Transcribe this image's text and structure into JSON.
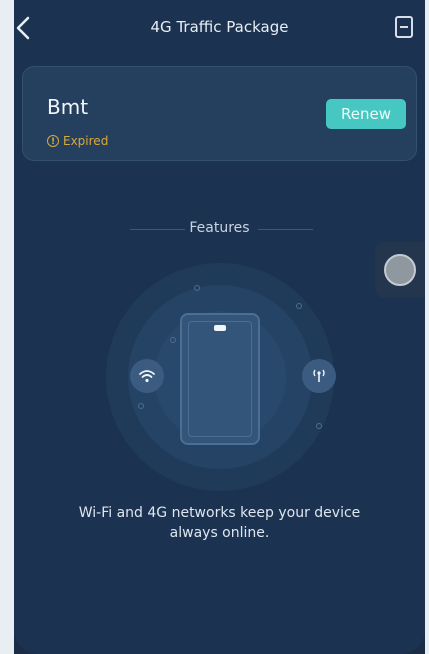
{
  "header": {
    "title": "4G Traffic Package",
    "back_icon": "chevron-left-icon",
    "menu_icon": "document-icon"
  },
  "plan": {
    "name": "Bmt",
    "status": "Expired",
    "status_color": "#d8a93b",
    "renew_label": "Renew",
    "accent": "#47c7c2"
  },
  "features": {
    "title": "Features",
    "description": "Wi-Fi and 4G networks keep your device always online.",
    "icons": [
      "wifi-icon",
      "signal-antenna-icon",
      "phone-icon"
    ]
  }
}
